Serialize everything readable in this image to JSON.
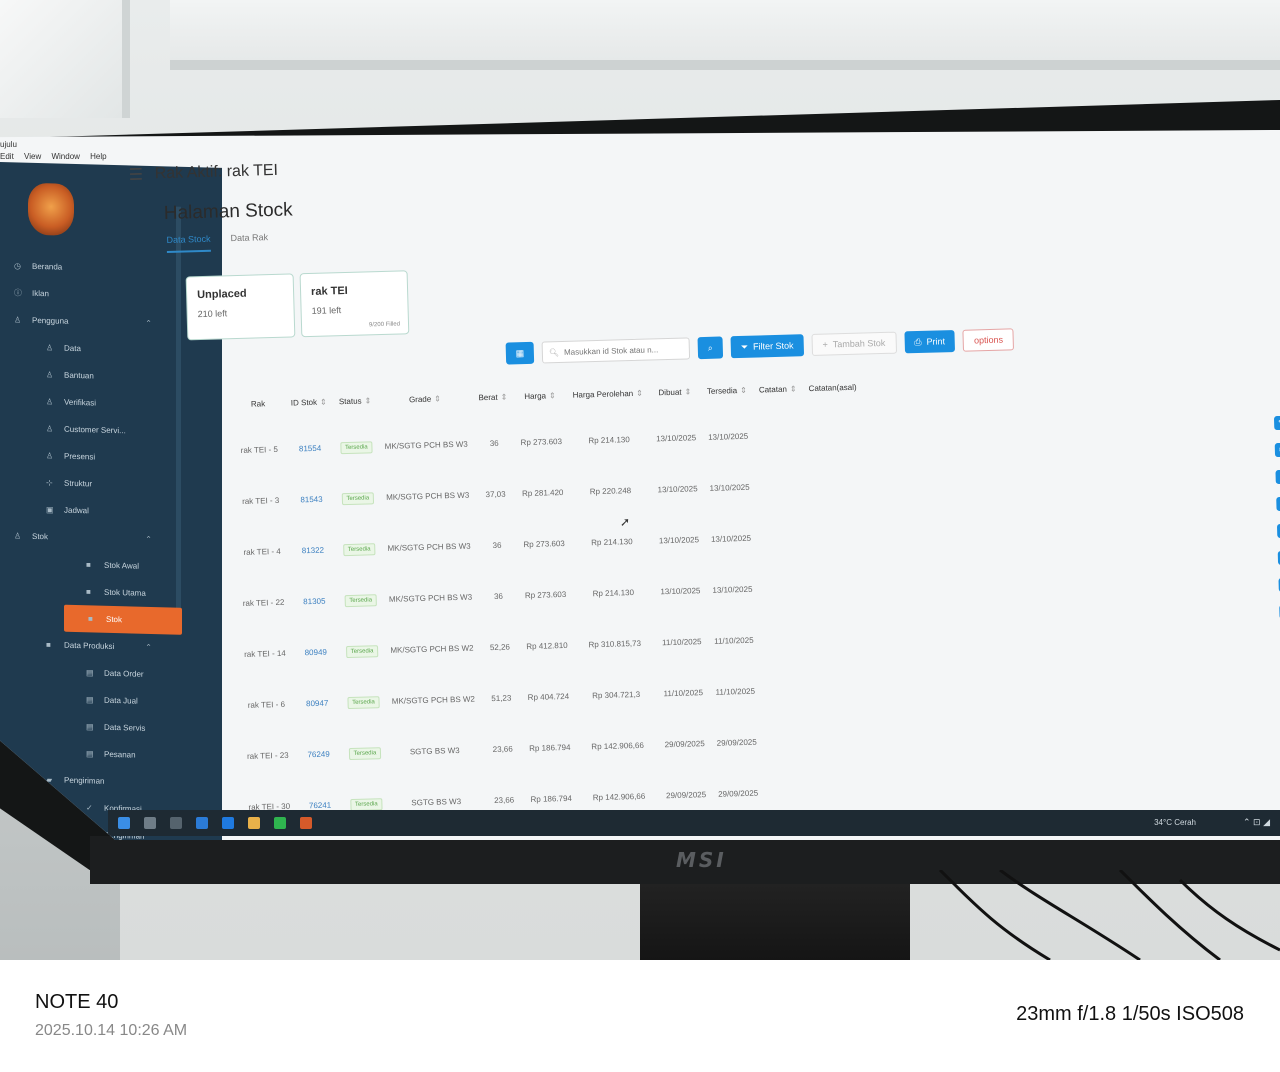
{
  "menubar": {
    "app": "ujulu",
    "items": [
      "Edit",
      "View",
      "Window",
      "Help"
    ]
  },
  "sidebar": {
    "items": [
      {
        "label": "Beranda",
        "icon": "clock-icon",
        "level": 0
      },
      {
        "label": "Iklan",
        "icon": "info-icon",
        "level": 0
      },
      {
        "label": "Pengguna",
        "icon": "user-icon",
        "level": 0,
        "expanded": true
      },
      {
        "label": "Data",
        "icon": "user-icon",
        "level": 1
      },
      {
        "label": "Bantuan",
        "icon": "user-icon",
        "level": 1
      },
      {
        "label": "Verifikasi",
        "icon": "user-icon",
        "level": 1
      },
      {
        "label": "Customer Servi...",
        "icon": "user-icon",
        "level": 1
      },
      {
        "label": "Presensi",
        "icon": "user-icon",
        "level": 1
      },
      {
        "label": "Struktur",
        "icon": "sitemap-icon",
        "level": 1
      },
      {
        "label": "Jadwal",
        "icon": "calendar-icon",
        "level": 1
      },
      {
        "label": "Stok",
        "icon": "user-icon",
        "level": 0,
        "expanded": true
      },
      {
        "label": "Stok Awal",
        "icon": "box-icon",
        "level": 2
      },
      {
        "label": "Stok Utama",
        "icon": "box-icon",
        "level": 2
      },
      {
        "label": "Stok",
        "icon": "box-icon",
        "level": 2,
        "active": true
      },
      {
        "label": "Data Produksi",
        "icon": "box-icon",
        "level": 1,
        "expanded": true
      },
      {
        "label": "Data Order",
        "icon": "cart-icon",
        "level": 2
      },
      {
        "label": "Data Jual",
        "icon": "cart-icon",
        "level": 2
      },
      {
        "label": "Data Servis",
        "icon": "cart-icon",
        "level": 2
      },
      {
        "label": "Pesanan",
        "icon": "cart-icon",
        "level": 2
      },
      {
        "label": "Pengiriman",
        "icon": "truck-icon",
        "level": 1
      },
      {
        "label": "Konfirmasi",
        "icon": "check-icon",
        "level": 2
      },
      {
        "label": "Pengiriman",
        "icon": "truck-icon",
        "level": 2
      }
    ]
  },
  "header": {
    "rack_title": "Rak Aktif: rak TEI",
    "page_title": "Halaman Stock",
    "tabs": [
      "Data Stock",
      "Data Rak"
    ]
  },
  "racks": [
    {
      "name": "Unplaced",
      "left": "210 left",
      "capacity": ""
    },
    {
      "name": "rak TEI",
      "left": "191 left",
      "capacity": "9/200 Filled"
    }
  ],
  "toolbar": {
    "search_placeholder": "Masukkan id Stok atau n...",
    "filter_label": "Filter Stok",
    "tambah_label": "Tambah Stok",
    "print_label": "Print",
    "options_label": "options"
  },
  "table": {
    "headers": [
      "Rak",
      "ID Stok",
      "Status",
      "Grade",
      "Berat",
      "Harga",
      "Harga Perolehan",
      "Dibuat",
      "Tersedia",
      "Catatan",
      "Catatan(asal)"
    ],
    "rows": [
      [
        "rak TEI - 5",
        "81554",
        "Tersedia",
        "MK/SGTG PCH BS W3",
        "36",
        "Rp 273.603",
        "Rp 214.130",
        "13/10/2025",
        "13/10/2025"
      ],
      [
        "rak TEI - 3",
        "81543",
        "Tersedia",
        "MK/SGTG PCH BS W3",
        "37,03",
        "Rp 281.420",
        "Rp 220.248",
        "13/10/2025",
        "13/10/2025"
      ],
      [
        "rak TEI - 4",
        "81322",
        "Tersedia",
        "MK/SGTG PCH BS W3",
        "36",
        "Rp 273.603",
        "Rp 214.130",
        "13/10/2025",
        "13/10/2025"
      ],
      [
        "rak TEI - 22",
        "81305",
        "Tersedia",
        "MK/SGTG PCH BS W3",
        "36",
        "Rp 273.603",
        "Rp 214.130",
        "13/10/2025",
        "13/10/2025"
      ],
      [
        "rak TEI - 14",
        "80949",
        "Tersedia",
        "MK/SGTG PCH BS W2",
        "52,26",
        "Rp 412.810",
        "Rp 310.815,73",
        "11/10/2025",
        "11/10/2025"
      ],
      [
        "rak TEI - 6",
        "80947",
        "Tersedia",
        "MK/SGTG PCH BS W2",
        "51,23",
        "Rp 404.724",
        "Rp 304.721,3",
        "11/10/2025",
        "11/10/2025"
      ],
      [
        "rak TEI - 23",
        "76249",
        "Tersedia",
        "SGTG BS W3",
        "23,66",
        "Rp 186.794",
        "Rp 142.906,66",
        "29/09/2025",
        "29/09/2025"
      ],
      [
        "rak TEI - 30",
        "76241",
        "Tersedia",
        "SGTG BS W3",
        "23,66",
        "Rp 186.794",
        "Rp 142.906,66",
        "29/09/2025",
        "29/09/2025"
      ]
    ]
  },
  "taskbar": {
    "weather": "34°C Cerah"
  },
  "caption": {
    "model": "NOTE 40",
    "datetime": "2025.10.14  10:26 AM",
    "exif": "23mm f/1.8 1/50s ISO508"
  },
  "colors": {
    "sidebar_bg": "#1f3a4f",
    "active_nav": "#e8692c",
    "primary": "#1a8fe0",
    "badge_green": "#5aa64c"
  }
}
